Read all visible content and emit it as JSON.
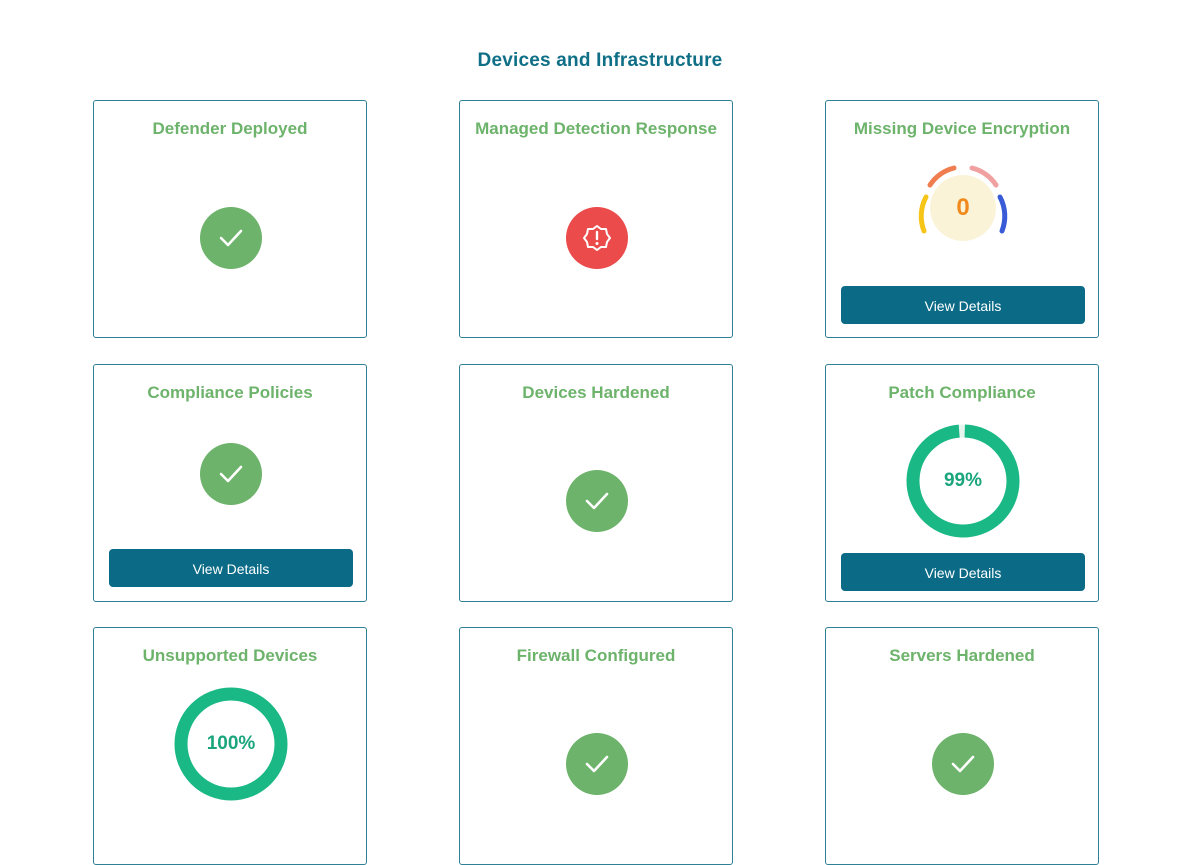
{
  "page": {
    "title": "Devices and Infrastructure"
  },
  "colors": {
    "title": "#0f6f86",
    "card_title": "#6db36b",
    "success": "#6db36b",
    "danger": "#eb4b4b",
    "button": "#0b6b87",
    "ring": "#1ab884",
    "gauge_value": "#f08a1c"
  },
  "cards": [
    {
      "title": "Defender Deployed",
      "status": "check-icon"
    },
    {
      "title": "Managed Detection Response",
      "status": "alert-icon"
    },
    {
      "title": "Missing Device Encryption",
      "value": "0",
      "button": "View Details"
    },
    {
      "title": "Compliance Policies",
      "status": "check-icon",
      "button": "View Details"
    },
    {
      "title": "Devices Hardened",
      "status": "check-icon"
    },
    {
      "title": "Patch Compliance",
      "percent": 99,
      "label": "99%",
      "button": "View Details"
    },
    {
      "title": "Unsupported Devices",
      "percent": 100,
      "label": "100%"
    },
    {
      "title": "Firewall Configured",
      "status": "check-icon"
    },
    {
      "title": "Servers Hardened",
      "status": "check-icon"
    }
  ]
}
